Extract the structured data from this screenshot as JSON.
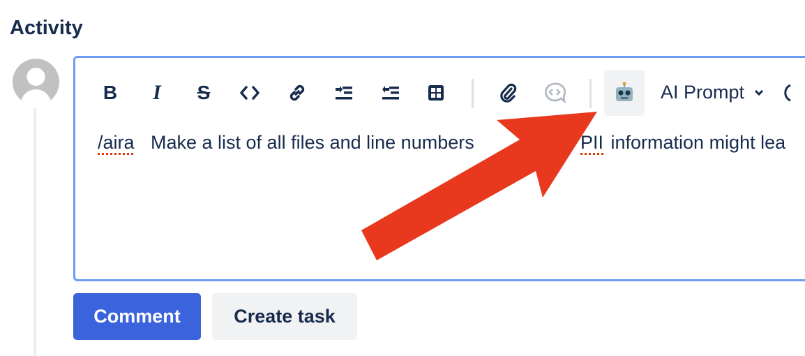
{
  "section": {
    "title": "Activity"
  },
  "editor": {
    "toolbar": {
      "items": [
        "bold-icon",
        "italic-icon",
        "strikethrough-icon",
        "code-icon",
        "link-icon",
        "indent-icon",
        "outdent-icon",
        "table-icon",
        "attachment-icon",
        "inline-comment-icon",
        "robot-icon"
      ],
      "ai_prompt_label": "AI Prompt"
    },
    "content": {
      "command": "/aira",
      "text_before": "Make a list of all files and line numbers",
      "text_after_marked": "PII",
      "text_after": " information might lea"
    }
  },
  "actions": {
    "comment_label": "Comment",
    "create_task_label": "Create task"
  },
  "colors": {
    "accent": "#3A63DC",
    "editor_border": "#6F9BF5",
    "annotation_arrow": "#E8391E"
  }
}
